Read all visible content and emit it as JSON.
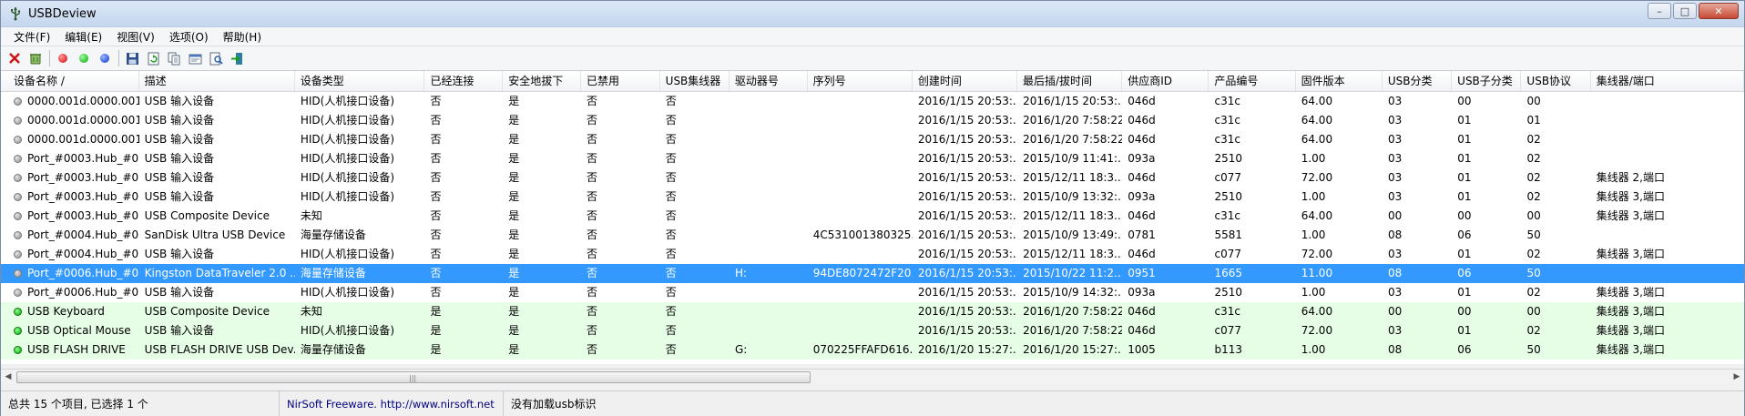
{
  "window": {
    "title": "USBDeview"
  },
  "menu": [
    {
      "label": "文件(F)"
    },
    {
      "label": "编辑(E)"
    },
    {
      "label": "视图(V)"
    },
    {
      "label": "选项(O)"
    },
    {
      "label": "帮助(H)"
    }
  ],
  "columns": [
    "设备名称  /",
    "描述",
    "设备类型",
    "已经连接",
    "安全地拔下",
    "已禁用",
    "USB集线器",
    "驱动器号",
    "序列号",
    "创建时间",
    "最后插/拔时间",
    "供应商ID",
    "产品编号",
    "固件版本",
    "USB分类",
    "USB子分类",
    "USB协议",
    "集线器/端口"
  ],
  "rows": [
    {
      "status": "gray",
      "state": "normal",
      "cells": [
        "0000.001d.0000.001...",
        "USB 输入设备",
        "HID(人机接口设备)",
        "否",
        "是",
        "否",
        "否",
        "",
        "",
        "2016/1/15 20:53:...",
        "2016/1/15 20:53:...",
        "046d",
        "c31c",
        "64.00",
        "03",
        "00",
        "00",
        ""
      ]
    },
    {
      "status": "gray",
      "state": "normal",
      "cells": [
        "0000.001d.0000.001...",
        "USB 输入设备",
        "HID(人机接口设备)",
        "否",
        "是",
        "否",
        "否",
        "",
        "",
        "2016/1/15 20:53:...",
        "2016/1/20 7:58:22",
        "046d",
        "c31c",
        "64.00",
        "03",
        "01",
        "01",
        ""
      ]
    },
    {
      "status": "gray",
      "state": "normal",
      "cells": [
        "0000.001d.0000.001...",
        "USB 输入设备",
        "HID(人机接口设备)",
        "否",
        "是",
        "否",
        "否",
        "",
        "",
        "2016/1/15 20:53:...",
        "2016/1/20 7:58:22",
        "046d",
        "c31c",
        "64.00",
        "03",
        "01",
        "02",
        ""
      ]
    },
    {
      "status": "gray",
      "state": "normal",
      "cells": [
        "Port_#0003.Hub_#0...",
        "USB 输入设备",
        "HID(人机接口设备)",
        "否",
        "是",
        "否",
        "否",
        "",
        "",
        "2016/1/15 20:53:...",
        "2015/10/9 11:41:...",
        "093a",
        "2510",
        "1.00",
        "03",
        "01",
        "02",
        ""
      ]
    },
    {
      "status": "gray",
      "state": "normal",
      "cells": [
        "Port_#0003.Hub_#0...",
        "USB 输入设备",
        "HID(人机接口设备)",
        "否",
        "是",
        "否",
        "否",
        "",
        "",
        "2016/1/15 20:53:...",
        "2015/12/11 18:3...",
        "046d",
        "c077",
        "72.00",
        "03",
        "01",
        "02",
        "集线器 2,端口"
      ]
    },
    {
      "status": "gray",
      "state": "normal",
      "cells": [
        "Port_#0003.Hub_#0...",
        "USB 输入设备",
        "HID(人机接口设备)",
        "否",
        "是",
        "否",
        "否",
        "",
        "",
        "2016/1/15 20:53:...",
        "2015/10/9 13:32:...",
        "093a",
        "2510",
        "1.00",
        "03",
        "01",
        "02",
        "集线器 3,端口"
      ]
    },
    {
      "status": "gray",
      "state": "normal",
      "cells": [
        "Port_#0003.Hub_#0...",
        "USB Composite Device",
        "未知",
        "否",
        "是",
        "否",
        "否",
        "",
        "",
        "2016/1/15 20:53:...",
        "2015/12/11 18:3...",
        "046d",
        "c31c",
        "64.00",
        "00",
        "00",
        "00",
        "集线器 3,端口"
      ]
    },
    {
      "status": "gray",
      "state": "normal",
      "cells": [
        "Port_#0004.Hub_#0...",
        "SanDisk Ultra USB Device",
        "海量存储设备",
        "否",
        "是",
        "否",
        "否",
        "",
        "4C531001380325...",
        "2016/1/15 20:53:...",
        "2015/10/9 13:49:...",
        "0781",
        "5581",
        "1.00",
        "08",
        "06",
        "50",
        ""
      ]
    },
    {
      "status": "gray",
      "state": "normal",
      "cells": [
        "Port_#0004.Hub_#0...",
        "USB 输入设备",
        "HID(人机接口设备)",
        "否",
        "是",
        "否",
        "否",
        "",
        "",
        "2016/1/15 20:53:...",
        "2015/12/11 18:3...",
        "046d",
        "c077",
        "72.00",
        "03",
        "01",
        "02",
        "集线器 3,端口"
      ]
    },
    {
      "status": "gray",
      "state": "selected",
      "cells": [
        "Port_#0006.Hub_#0...",
        "Kingston DataTraveler 2.0 ...",
        "海量存储设备",
        "否",
        "是",
        "否",
        "否",
        "H:",
        "94DE8072472F20...",
        "2016/1/15 20:53:...",
        "2015/10/22 11:2...",
        "0951",
        "1665",
        "11.00",
        "08",
        "06",
        "50",
        ""
      ]
    },
    {
      "status": "gray",
      "state": "normal",
      "cells": [
        "Port_#0006.Hub_#0...",
        "USB 输入设备",
        "HID(人机接口设备)",
        "否",
        "是",
        "否",
        "否",
        "",
        "",
        "2016/1/15 20:53:...",
        "2015/10/9 14:32:...",
        "093a",
        "2510",
        "1.00",
        "03",
        "01",
        "02",
        "集线器 3,端口"
      ]
    },
    {
      "status": "green",
      "state": "green",
      "cells": [
        "USB Keyboard",
        "USB Composite Device",
        "未知",
        "是",
        "是",
        "否",
        "否",
        "",
        "",
        "2016/1/15 20:53:...",
        "2016/1/20 7:58:22",
        "046d",
        "c31c",
        "64.00",
        "00",
        "00",
        "00",
        "集线器 3,端口"
      ]
    },
    {
      "status": "green",
      "state": "green",
      "cells": [
        "USB Optical Mouse",
        "USB 输入设备",
        "HID(人机接口设备)",
        "是",
        "是",
        "否",
        "否",
        "",
        "",
        "2016/1/15 20:53:...",
        "2016/1/20 7:58:22",
        "046d",
        "c077",
        "72.00",
        "03",
        "01",
        "02",
        "集线器 3,端口"
      ]
    },
    {
      "status": "green",
      "state": "green",
      "cells": [
        "USB FLASH DRIVE",
        "USB FLASH DRIVE USB Dev...",
        "海量存储设备",
        "是",
        "是",
        "否",
        "否",
        "G:",
        "070225FFAFD616...",
        "2016/1/20 15:27:...",
        "2016/1/20 15:27:...",
        "1005",
        "b113",
        "1.00",
        "08",
        "06",
        "50",
        "集线器 3,端口"
      ]
    }
  ],
  "status": {
    "count": "总共 15 个项目, 已选择 1 个",
    "link": "NirSoft Freeware.  http://www.nirsoft.net",
    "message": "没有加载usb标识"
  }
}
